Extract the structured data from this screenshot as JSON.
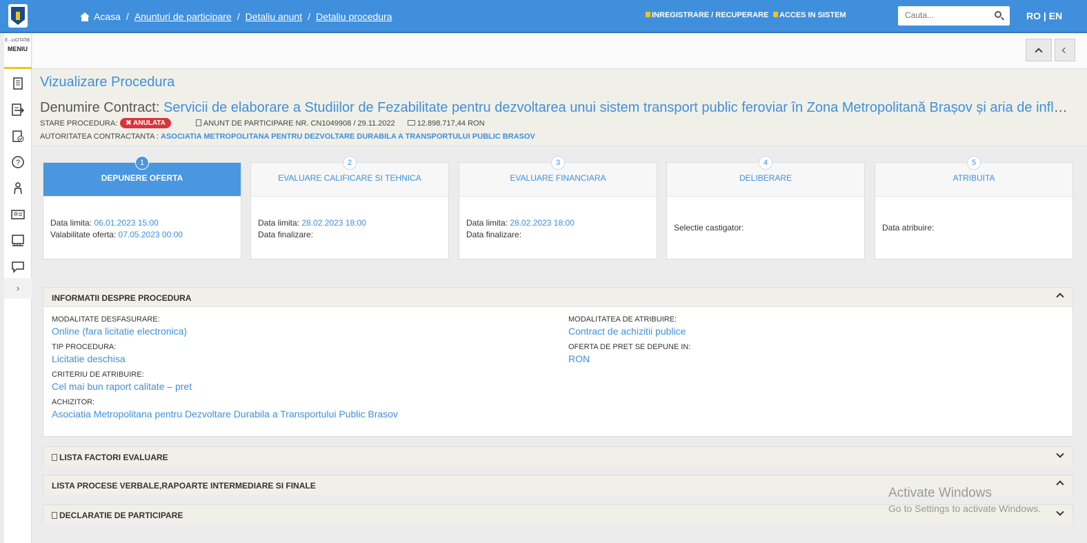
{
  "topbar": {
    "breadcrumbs": [
      "Acasa",
      "Anunturi de participare",
      "Detaliu anunt",
      "Detaliu procedura"
    ],
    "register_label": "INREGISTRARE / RECUPERARE",
    "login_label": "ACCES IN SISTEM",
    "search_placeholder": "Cauta...",
    "lang": "RO | EN"
  },
  "sidebar": {
    "small_label": "E - LICITATIE",
    "menu_label": "MENIU",
    "icons": [
      "document-icon",
      "list-arrow-icon",
      "clipboard-check-icon",
      "help-icon",
      "users-icon",
      "id-card-icon",
      "folders-icon",
      "chat-icon"
    ],
    "expand": "›"
  },
  "header": {
    "title": "Vizualizare Procedura",
    "contract_label": "Denumire Contract:",
    "contract_name": "Servicii de elaborare a Studiilor de Fezabilitate pentru dezvoltarea unui sistem transport public feroviar în Zona Metropolitană Brașov și aria de influe...",
    "stare_label": "STARE PROCEDURA:",
    "stare_value": "✖ ANULATA",
    "anunt": "ANUNT DE PARTICIPARE NR. CN1049908 / 29.11.2022",
    "valoare": "12.898.717,44  RON",
    "autoritate_label": "AUTORITATEA CONTRACTANTA :",
    "autoritate_value": "ASOCIATIA METROPOLITANA PENTRU DEZVOLTARE DURABILA A TRANSPORTULUI PUBLIC BRASOV"
  },
  "steps": [
    {
      "num": "1",
      "title": "DEPUNERE OFERTA",
      "l1": "Data limita:",
      "v1": "06.01.2023 15:00",
      "l2": "Valabilitate oferta:",
      "v2": "07.05.2023 00:00"
    },
    {
      "num": "2",
      "title": "EVALUARE CALIFICARE SI TEHNICA",
      "l1": "Data limita:",
      "v1": "28.02.2023 18:00",
      "l2": "Data finalizare:",
      "v2": ""
    },
    {
      "num": "3",
      "title": "EVALUARE FINANCIARA",
      "l1": "Data limita:",
      "v1": "28.02.2023 18:00",
      "l2": "Data finalizare:",
      "v2": ""
    },
    {
      "num": "4",
      "title": "DELIBERARE",
      "l1": "Selectie castigator:",
      "v1": ""
    },
    {
      "num": "5",
      "title": "ATRIBUITA",
      "l1": "Data atribuire:",
      "v1": ""
    }
  ],
  "info": {
    "title": "INFORMATII DESPRE PROCEDURA",
    "left": [
      {
        "label": "MODALITATE DESFASURARE:",
        "value": "Online (fara licitatie electronica)"
      },
      {
        "label": "TIP PROCEDURA:",
        "value": "Licitatie deschisa"
      },
      {
        "label": "CRITERIU DE ATRIBUIRE:",
        "value": "Cel mai bun raport calitate – pret"
      },
      {
        "label": "ACHIZITOR:",
        "value": "Asociatia Metropolitana pentru Dezvoltare Durabila a Transportului Public Brasov"
      }
    ],
    "right": [
      {
        "label": "MODALITATEA DE ATRIBUIRE:",
        "value": "Contract de achizitii publice"
      },
      {
        "label": "OFERTA DE PRET SE DEPUNE IN:",
        "value": "RON"
      }
    ]
  },
  "sections": {
    "factori": "LISTA FACTORI EVALUARE",
    "procese": "LISTA PROCESE VERBALE,RAPOARTE INTERMEDIARE SI FINALE",
    "declaratie": "DECLARATIE DE PARTICIPARE"
  },
  "watermark": {
    "line1": "Activate Windows",
    "line2": "Go to Settings to activate Windows."
  }
}
